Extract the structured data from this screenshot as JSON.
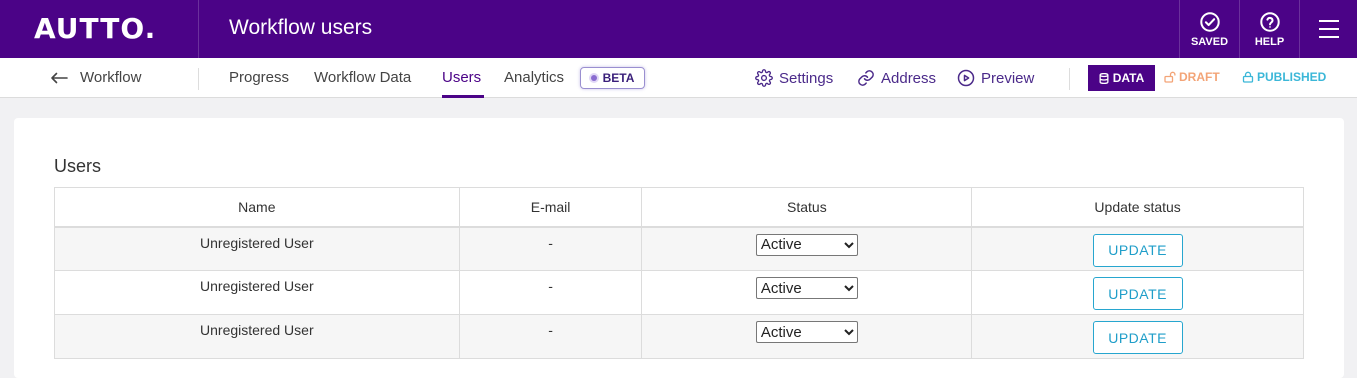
{
  "header": {
    "logo": "AUTTO.",
    "title": "Workflow users",
    "saved_label": "SAVED",
    "help_label": "HELP"
  },
  "subnav": {
    "back_label": "Workflow",
    "tabs": [
      {
        "label": "Progress"
      },
      {
        "label": "Workflow Data"
      },
      {
        "label": "Users",
        "active": true
      },
      {
        "label": "Analytics"
      }
    ],
    "beta_label": "BETA",
    "links": {
      "settings": "Settings",
      "address": "Address",
      "preview": "Preview"
    },
    "modes": {
      "data": "DATA",
      "draft": "DRAFT",
      "published": "PUBLISHED"
    }
  },
  "users": {
    "title": "Users",
    "columns": [
      "Name",
      "E-mail",
      "Status",
      "Update status"
    ],
    "rows": [
      {
        "name": "Unregistered User",
        "email": "-",
        "status": "Active",
        "action": "UPDATE"
      },
      {
        "name": "Unregistered User",
        "email": "-",
        "status": "Active",
        "action": "UPDATE"
      },
      {
        "name": "Unregistered User",
        "email": "-",
        "status": "Active",
        "action": "UPDATE"
      }
    ]
  },
  "colors": {
    "brand": "#4b0387",
    "draft": "#f3a477",
    "published": "#3bb7d8",
    "update_button": "#1f9ec9"
  }
}
